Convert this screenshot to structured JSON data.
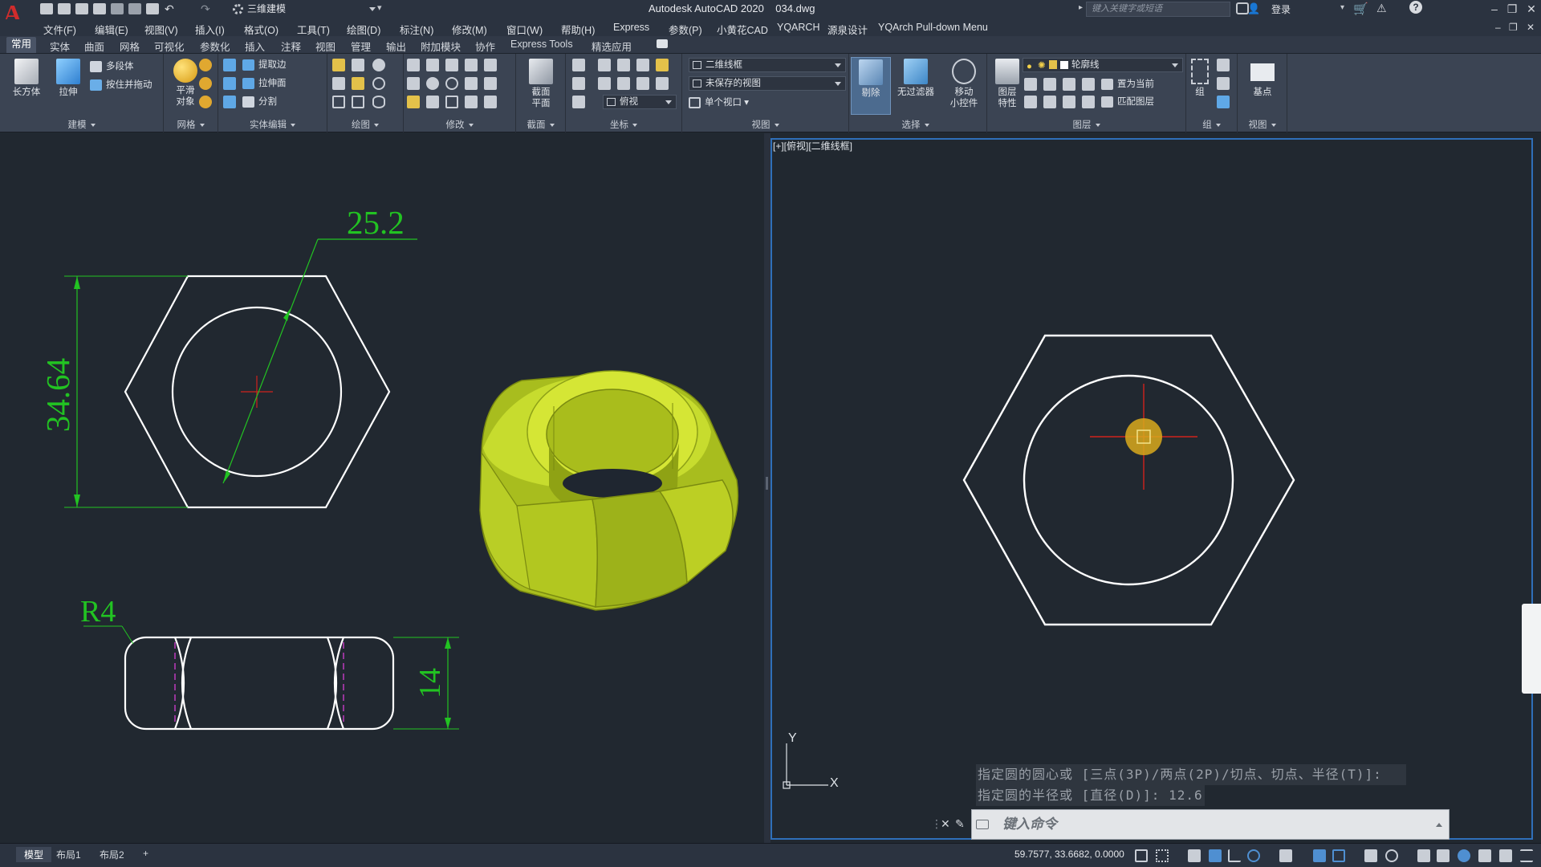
{
  "app": {
    "title": "Autodesk AutoCAD 2020",
    "filename": "034.dwg",
    "workspace": "三维建模",
    "search_placeholder": "键入关键字或短语",
    "login": "登录",
    "logo_letter": "A"
  },
  "menu": [
    "文件(F)",
    "编辑(E)",
    "视图(V)",
    "插入(I)",
    "格式(O)",
    "工具(T)",
    "绘图(D)",
    "标注(N)",
    "修改(M)",
    "窗口(W)",
    "帮助(H)",
    "Express",
    "参数(P)",
    "小黄花CAD",
    "YQARCH",
    "源泉设计",
    "YQArch Pull-down Menu"
  ],
  "ribbon_tabs": [
    "常用",
    "实体",
    "曲面",
    "网格",
    "可视化",
    "参数化",
    "插入",
    "注释",
    "视图",
    "管理",
    "输出",
    "附加模块",
    "协作",
    "Express Tools",
    "精选应用"
  ],
  "ribbon": {
    "modeling": {
      "label": "建模",
      "box": "长方体",
      "extrude": "拉伸",
      "polysolid": "多段体",
      "presspull": "按住并拖动"
    },
    "mesh": {
      "label": "网格",
      "smooth": "平滑\n对象"
    },
    "solid_edit": {
      "label": "实体编辑",
      "extract": "提取边",
      "extrude_face": "拉伸面",
      "separate": "分割"
    },
    "draw": {
      "label": "绘图"
    },
    "modify": {
      "label": "修改"
    },
    "section": {
      "label": "截面",
      "plane": "截面\n平面"
    },
    "coords": {
      "label": "坐标",
      "view": "俯视"
    },
    "view": {
      "label": "视图",
      "visual_style": "二维线框",
      "saved_view": "未保存的视图",
      "viewport": "单个视口"
    },
    "selection": {
      "label": "选择",
      "cull": "剔除",
      "nofilter": "无过滤器",
      "gizmo": "移动\n小控件"
    },
    "layers": {
      "label": "图层",
      "props": "图层\n特性",
      "layer_name": "轮廓线",
      "set_current": "置为当前",
      "match": "匹配图层"
    },
    "groups": {
      "label": "组",
      "group": "组"
    },
    "view2": {
      "label": "视图",
      "base": "基点"
    }
  },
  "viewport": {
    "right_label": "[+][俯视][二维线框]",
    "dim_diameter": "25.2",
    "dim_height": "34.64",
    "dim_radius": "R4",
    "dim_thickness": "14",
    "ucs_x": "X",
    "ucs_y": "Y"
  },
  "command": {
    "history": [
      "指定圆的圆心或 [三点(3P)/两点(2P)/切点、切点、半径(T)]:",
      "指定圆的半径或 [直径(D)]: 12.6"
    ],
    "placeholder": "键入命令"
  },
  "status": {
    "tabs": [
      "模型",
      "布局1",
      "布局2"
    ],
    "coords": "59.7577, 33.6682, 0.0000"
  },
  "colors": {
    "dimension": "#22c322",
    "center": "#d0221c",
    "nut": "#b6cc22",
    "viewport_border": "#2f6fb9",
    "background": "#212830"
  }
}
